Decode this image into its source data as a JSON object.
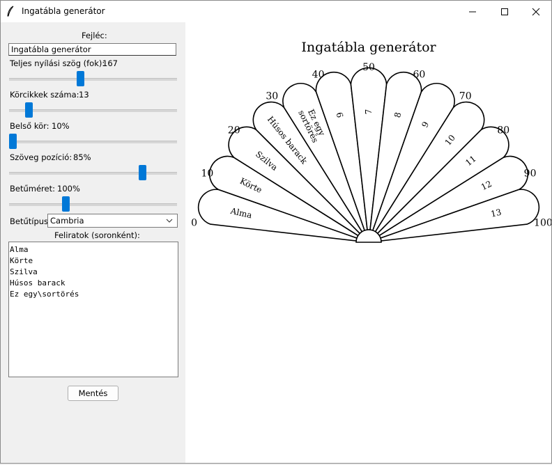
{
  "window": {
    "title": "Ingatábla generátor"
  },
  "form": {
    "header_label": "Fejléc:",
    "header_value": "Ingatábla generátor",
    "angle_label": "Teljes nyílási szög (fok):",
    "angle_value": "167",
    "angle_fraction": 0.42,
    "segments_label": "Körcikkek száma:",
    "segments_value": "13",
    "segments_fraction": 0.1,
    "inner_label": "Belső kör:",
    "inner_value": "10%",
    "inner_fraction": 0.0,
    "textpos_label": "Szöveg pozíció:",
    "textpos_value": "85%",
    "textpos_fraction": 0.81,
    "fontsize_label": "Betűméret:",
    "fontsize_value": "100%",
    "fontsize_fraction": 0.33,
    "font_label": "Betűtípus:",
    "font_value": "Cambria",
    "labels_label": "Feliratok (soronként):",
    "labels_lines": [
      "Alma",
      "Körte",
      "Szilva",
      "Húsos barack",
      "Ez egy\\sortörés"
    ],
    "save_label": "Mentés"
  },
  "preview": {
    "title": "Ingatábla generátor",
    "scale_labels": [
      "0",
      "10",
      "20",
      "30",
      "40",
      "50",
      "60",
      "70",
      "80",
      "90",
      "100"
    ],
    "segment_labels": [
      "Alma",
      "Körte",
      "Szilva",
      "Húsos barack",
      "Ez egy\nsortörés",
      "6",
      "7",
      "8",
      "9",
      "10",
      "11",
      "12",
      "13"
    ],
    "petal_fill": "#ffffff",
    "stroke": "#000000"
  },
  "colors": {
    "accent": "#0078d7",
    "window_bg": "#f0f0f0"
  }
}
